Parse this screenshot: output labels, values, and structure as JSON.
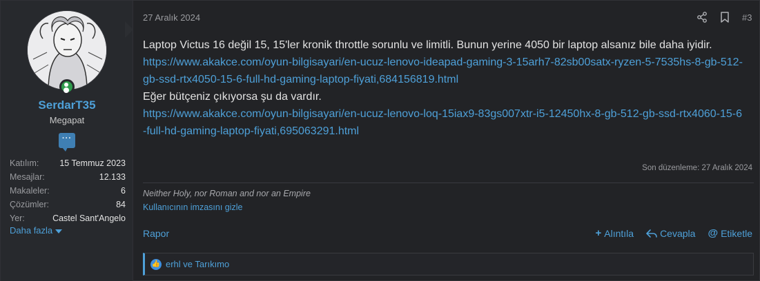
{
  "user": {
    "name": "SerdarT35",
    "title": "Megapat",
    "stats": [
      {
        "label": "Katılım:",
        "value": "15 Temmuz 2023"
      },
      {
        "label": "Mesajlar:",
        "value": "12.133"
      },
      {
        "label": "Makaleler:",
        "value": "6"
      },
      {
        "label": "Çözümler:",
        "value": "84"
      },
      {
        "label": "Yer:",
        "value": "Castel Sant'Angelo"
      }
    ],
    "more_label": "Daha fazla"
  },
  "post": {
    "date": "27 Aralık 2024",
    "number": "#3",
    "lines": {
      "p1": "Laptop Victus 16 değil 15, 15'ler kronik throttle sorunlu ve limitli. Bunun yerine 4050 bir laptop alsanız bile daha iyidir.",
      "link1": "https://www.akakce.com/oyun-bilgisayari/en-ucuz-lenovo-ideapad-gaming-3-15arh7-82sb00satx-ryzen-5-7535hs-8-gb-512-gb-ssd-rtx4050-15-6-full-hd-gaming-laptop-fiyati,684156819.html",
      "p2": "Eğer bütçeniz çıkıyorsa şu da vardır.",
      "link2": "https://www.akakce.com/oyun-bilgisayari/en-ucuz-lenovo-loq-15iax9-83gs007xtr-i5-12450hx-8-gb-512-gb-ssd-rtx4060-15-6-full-hd-gaming-laptop-fiyati,695063291.html"
    },
    "edited": "Son düzenleme: 27 Aralık 2024",
    "signature": "Neither Holy, nor Roman and nor an Empire",
    "hide_signature": "Kullanıcının imzasını gizle",
    "report": "Rapor",
    "actions": {
      "quote": "Alıntıla",
      "reply": "Cevapla",
      "tag": "Etiketle"
    },
    "reactions": "erhl ve Tarıkımo"
  },
  "colors": {
    "accent": "#4ea0d8",
    "online": "#2e9b4c",
    "background": "#222326"
  },
  "icons": [
    "share-icon",
    "bookmark-icon",
    "message-icon",
    "chevron-down-icon",
    "plus-icon",
    "reply-icon",
    "at-icon",
    "like-icon"
  ]
}
